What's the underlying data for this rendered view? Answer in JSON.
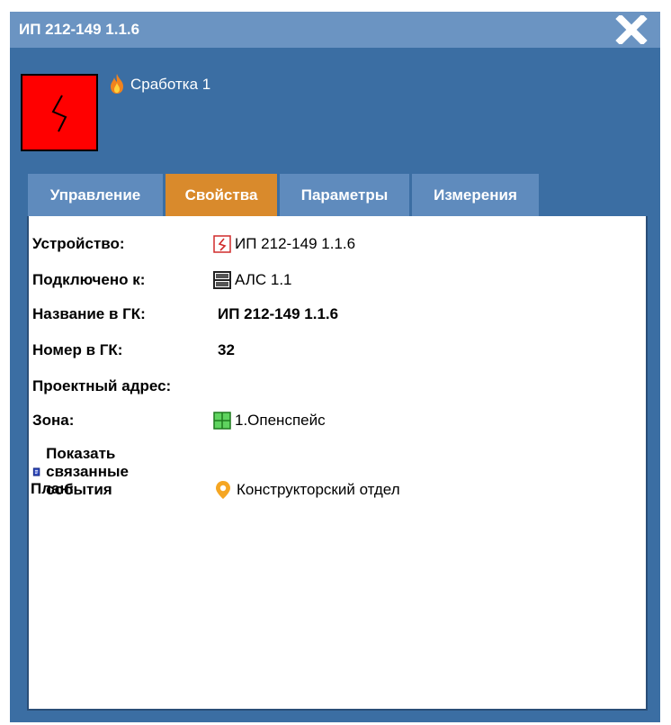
{
  "window": {
    "title": "ИП 212-149 1.1.6",
    "close_icon": "close-icon"
  },
  "status": {
    "state_icon": "flame-icon",
    "state_text": "Сработка 1"
  },
  "tabs": [
    {
      "label": "Управление",
      "active": false
    },
    {
      "label": "Свойства",
      "active": true
    },
    {
      "label": "Параметры",
      "active": false
    },
    {
      "label": "Измерения",
      "active": false
    }
  ],
  "properties": {
    "device": {
      "label": "Устройство:",
      "value": "ИП 212-149 1.1.6",
      "icon": "smoke-detector-icon"
    },
    "connected": {
      "label": "Подключено к:",
      "value": "АЛС 1.1",
      "icon": "als-icon"
    },
    "gk_name": {
      "label": "Название в ГК:",
      "value": "ИП 212-149 1.1.6"
    },
    "gk_number": {
      "label": "Номер в ГК:",
      "value": "32"
    },
    "project_address": {
      "label": "Проектный адрес:",
      "value": ""
    },
    "zone": {
      "label": "Зона:",
      "value": "1.Опенспейс",
      "icon": "zone-icon"
    },
    "events_link": {
      "label": "Показать связанные события",
      "icon": "journal-icon"
    },
    "plan": {
      "label": "План:",
      "value": "Конструкторский отдел",
      "icon": "location-pin-icon"
    }
  },
  "colors": {
    "window_bg": "#3b6ea3",
    "titlebar_bg": "#6b94c2",
    "tab_bg": "#5f8bbd",
    "tab_active_bg": "#d98a2c",
    "alarm_red": "#ff0000"
  }
}
